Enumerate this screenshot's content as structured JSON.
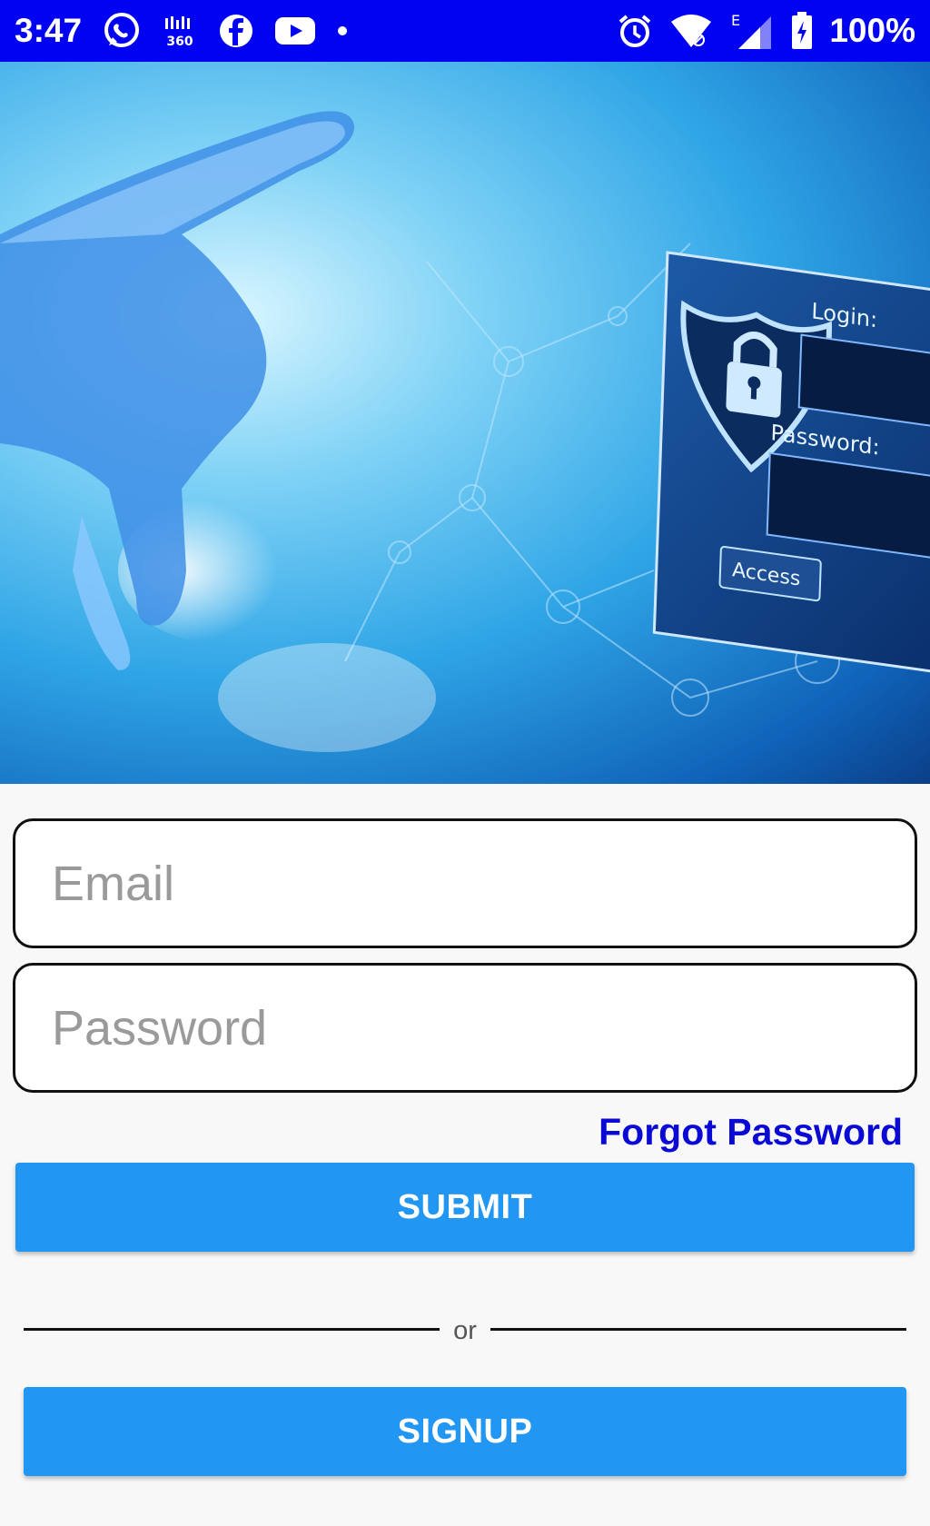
{
  "status_bar": {
    "time": "3:47",
    "battery": "100%",
    "background": "#0202f2",
    "icons_left": [
      "whatsapp-icon",
      "app-360-icon",
      "facebook-icon",
      "youtube-icon",
      "dot-icon"
    ],
    "icons_right": [
      "alarm-icon",
      "wifi-icon",
      "signal-icon",
      "battery-charging-icon"
    ]
  },
  "hero": {
    "image": "hand-touching-security-login-panel",
    "panel_login_label": "Login:",
    "panel_password_label": "Password:",
    "panel_access_label": "Access"
  },
  "form": {
    "email_placeholder": "Email",
    "password_placeholder": "Password",
    "forgot_label": "Forgot Password",
    "submit_label": "SUBMIT",
    "divider_text": "or",
    "signup_label": "SIGNUP"
  },
  "colors": {
    "accent": "#2196f3",
    "link": "#0a0ad4"
  }
}
